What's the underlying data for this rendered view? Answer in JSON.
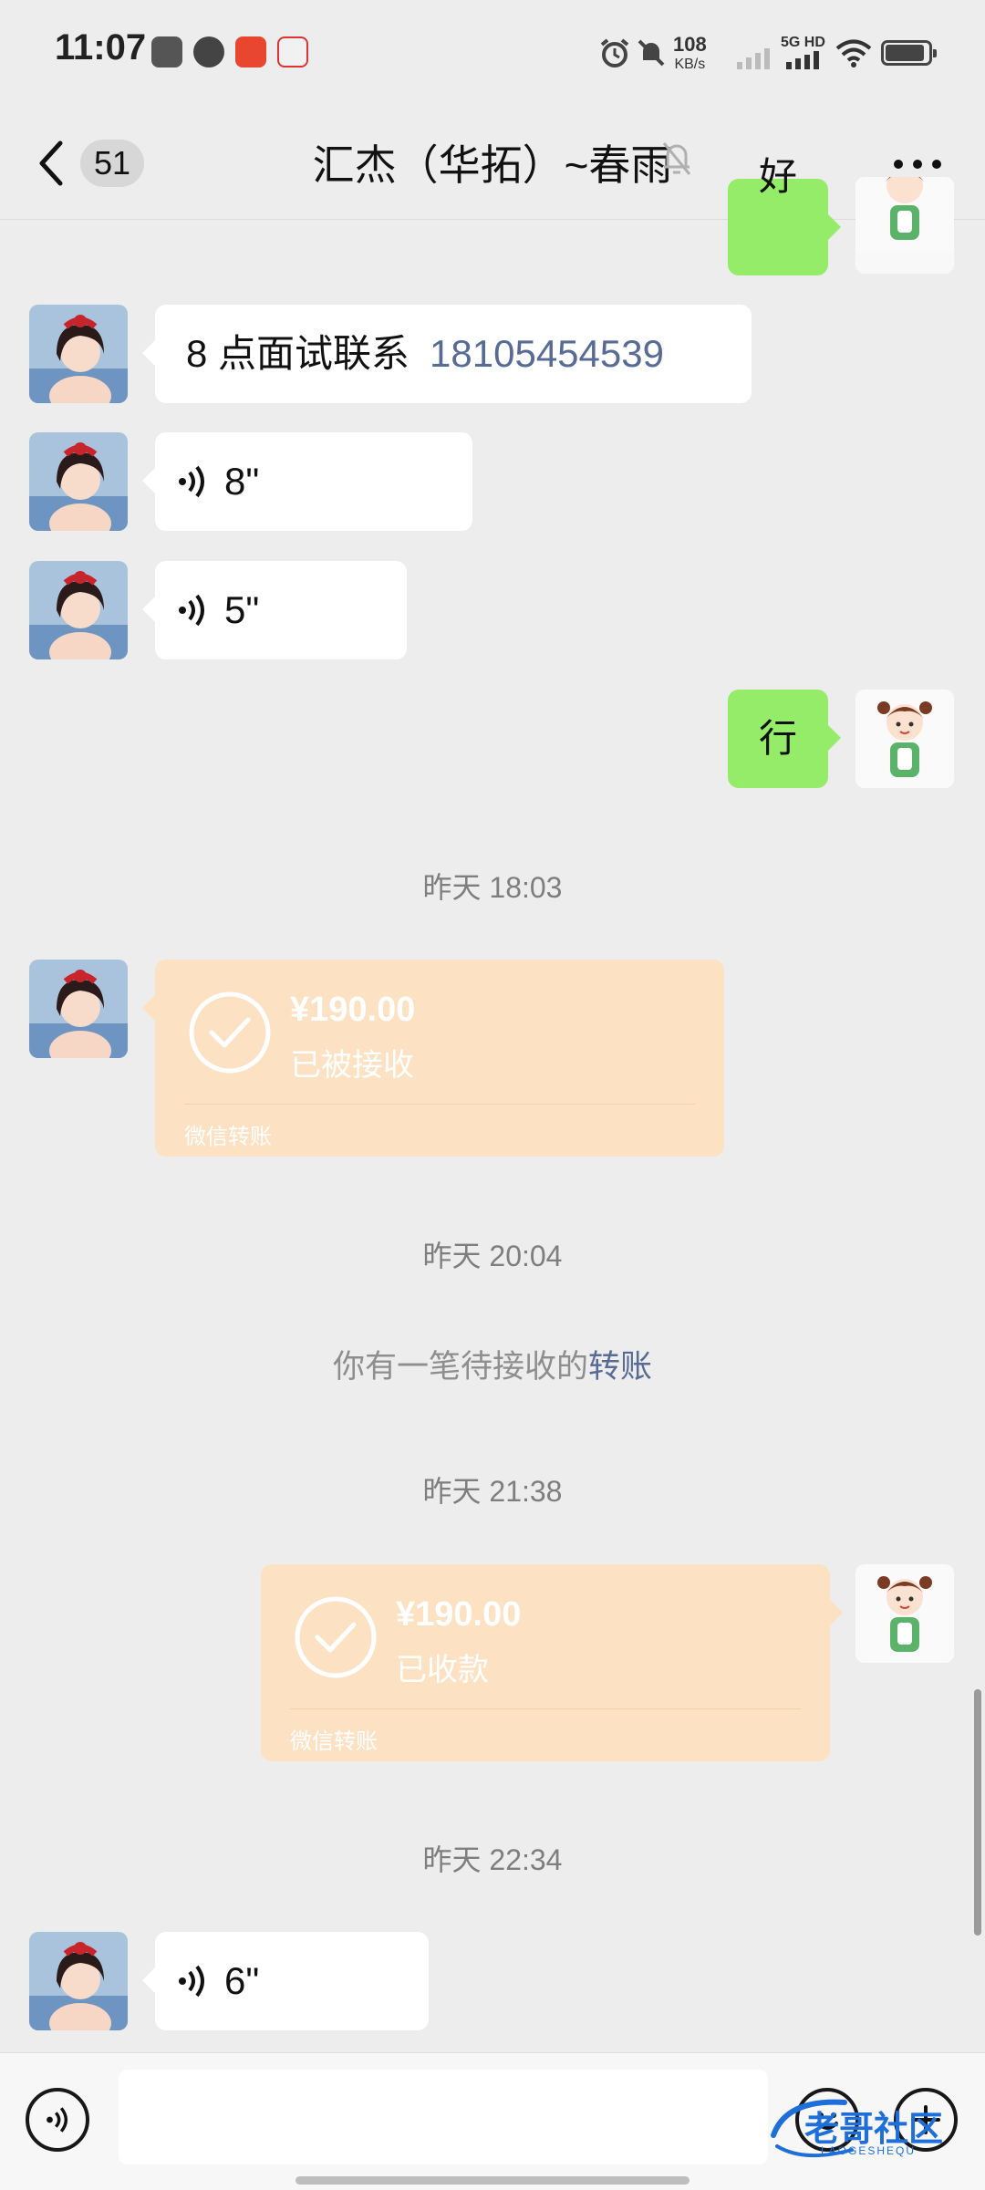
{
  "status_bar": {
    "time": "11:07",
    "net_speed": "108",
    "net_unit": "KB/s",
    "network_type": "5G HD"
  },
  "header": {
    "unread_count": "51",
    "title": "汇杰（华拓）~春雨"
  },
  "messages": [
    {
      "type": "text",
      "side": "right",
      "text": "好"
    },
    {
      "type": "text",
      "side": "left",
      "text": "8 点面试联系",
      "phone": "18105454539"
    },
    {
      "type": "voice",
      "side": "left",
      "duration": "8\""
    },
    {
      "type": "voice",
      "side": "left",
      "duration": "5\""
    },
    {
      "type": "text",
      "side": "right",
      "text": "行"
    },
    {
      "type": "time",
      "text": "昨天 18:03"
    },
    {
      "type": "transfer",
      "side": "left",
      "amount": "¥190.00",
      "status": "已被接收",
      "footer": "微信转账"
    },
    {
      "type": "time",
      "text": "昨天 20:04"
    },
    {
      "type": "system",
      "text": "你有一笔待接收的",
      "link": "转账"
    },
    {
      "type": "time",
      "text": "昨天 21:38"
    },
    {
      "type": "transfer",
      "side": "right",
      "amount": "¥190.00",
      "status": "已收款",
      "footer": "微信转账"
    },
    {
      "type": "time",
      "text": "昨天 22:34"
    },
    {
      "type": "voice",
      "side": "left",
      "duration": "6\""
    }
  ],
  "input": {
    "value": "",
    "placeholder": ""
  },
  "watermark": {
    "text": "老哥社区",
    "subtext": "LAOGESHEQU"
  },
  "colors": {
    "background": "#ededed",
    "self_bubble": "#95ec69",
    "other_bubble": "#ffffff",
    "transfer_card": "#fde1c3",
    "link": "#576b95"
  },
  "icons": [
    "back-chevron-icon",
    "mute-bell-icon",
    "more-dots-icon",
    "voice-wave-icon",
    "transfer-check-icon",
    "voice-mode-icon",
    "emoji-icon",
    "plus-icon"
  ]
}
